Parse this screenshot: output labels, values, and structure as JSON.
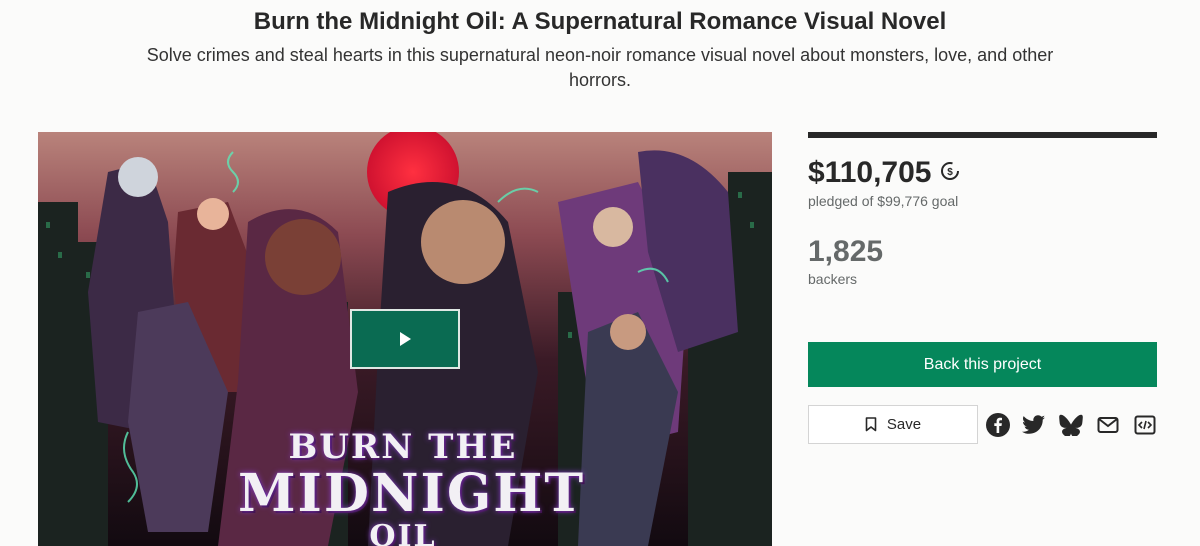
{
  "project": {
    "title": "Burn the Midnight Oil: A Supernatural Romance Visual Novel",
    "blurb": "Solve crimes and steal hearts in this supernatural neon-noir romance visual novel about monsters, love, and other horrors."
  },
  "media": {
    "logo_line1": "BURN THE",
    "logo_line2": "MIDNIGHT",
    "logo_line3": "OIL",
    "play_icon": "play-icon"
  },
  "stats": {
    "pledged": "$110,705",
    "goal_text": "pledged of $99,776 goal",
    "backers": "1,825",
    "backers_label": "backers",
    "currency_icon": "currency-conversion-icon"
  },
  "actions": {
    "back_label": "Back this project",
    "save_label": "Save",
    "share_icons": [
      "facebook-icon",
      "twitter-icon",
      "bluesky-icon",
      "email-icon",
      "embed-icon"
    ]
  },
  "colors": {
    "accent_green": "#05875b",
    "play_green": "#0a6b52",
    "text_dark": "#282828",
    "text_muted": "#656969"
  }
}
